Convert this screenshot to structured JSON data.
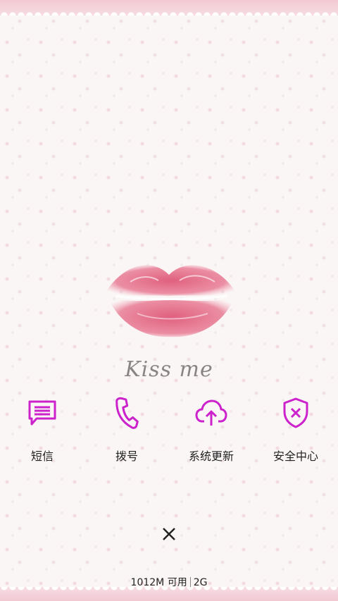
{
  "wallpaper": {
    "caption": "Kiss me",
    "accent_color": "#cc22cc"
  },
  "shortcuts": [
    {
      "label": "短信",
      "icon": "message-icon"
    },
    {
      "label": "拨号",
      "icon": "phone-icon"
    },
    {
      "label": "系统更新",
      "icon": "cloud-upload-icon"
    },
    {
      "label": "安全中心",
      "icon": "shield-x-icon"
    }
  ],
  "close": {
    "icon": "close-icon"
  },
  "status": {
    "memory": "1012M 可用",
    "network": "2G"
  }
}
